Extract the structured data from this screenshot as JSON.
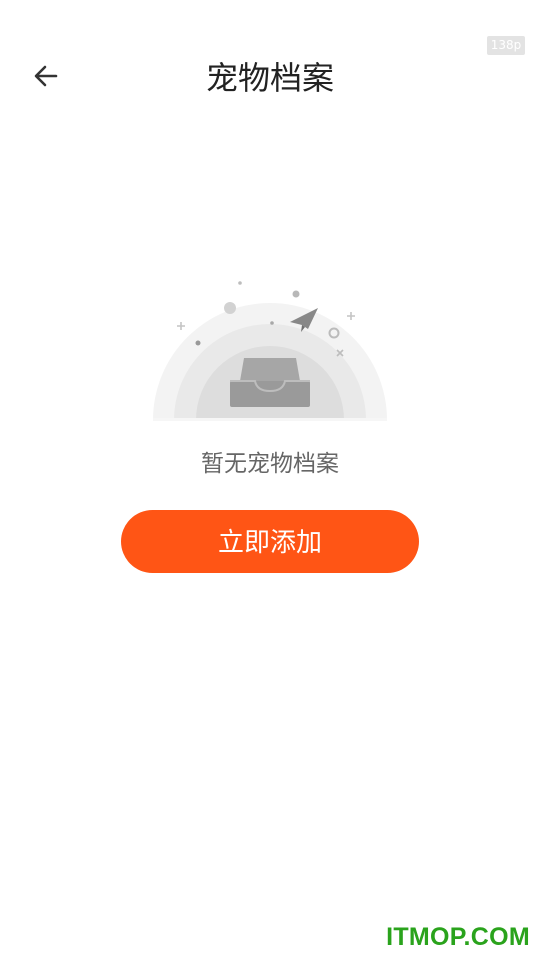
{
  "status": {
    "badge": "138p"
  },
  "header": {
    "title": "宠物档案"
  },
  "empty_state": {
    "message": "暂无宠物档案"
  },
  "actions": {
    "add_label": "立即添加"
  },
  "watermark": {
    "text": "ITMOP.COM"
  },
  "colors": {
    "accent": "#ff5515",
    "watermark": "#2aa31c"
  },
  "icons": {
    "back": "arrow-left-icon",
    "empty": "empty-inbox-illustration"
  }
}
